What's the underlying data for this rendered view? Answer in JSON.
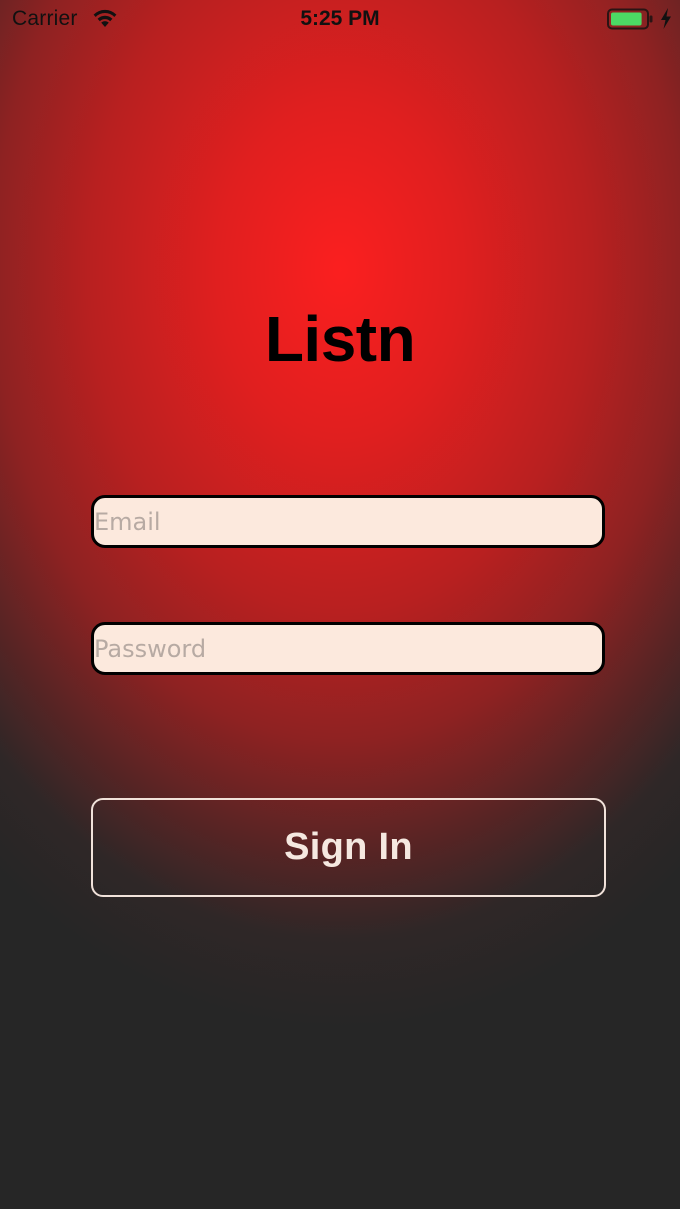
{
  "status_bar": {
    "carrier": "Carrier",
    "time": "5:25 PM",
    "wifi_icon": "wifi-icon",
    "battery_icon": "battery-charging-icon",
    "battery_level": 0.9,
    "colors": {
      "battery_fill": "#4cd964"
    }
  },
  "app": {
    "title": "Listn"
  },
  "login_form": {
    "email": {
      "placeholder": "Email",
      "value": ""
    },
    "password": {
      "placeholder": "Password",
      "value": ""
    },
    "sign_in_label": "Sign In"
  },
  "colors": {
    "gradient_center": "#fb1f1f",
    "gradient_edge": "#262626",
    "field_background": "#fce9dd",
    "placeholder": "#b7aaa3"
  }
}
